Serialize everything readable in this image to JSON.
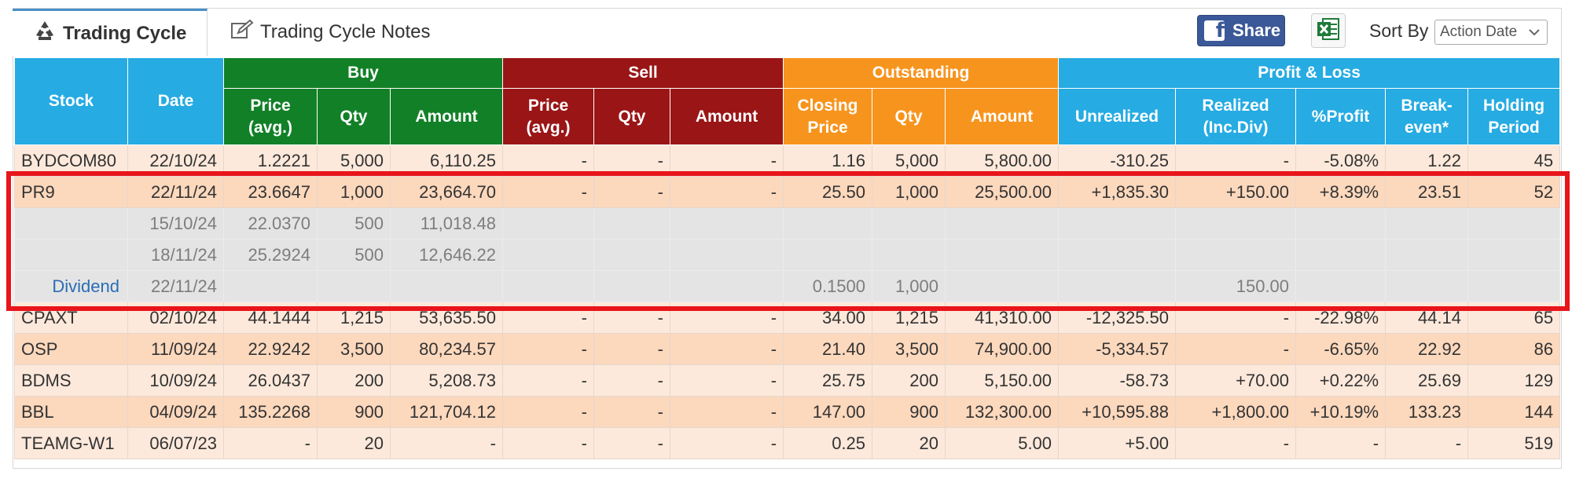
{
  "tabs": {
    "active": "Trading Cycle",
    "inactive": "Trading Cycle Notes"
  },
  "toolbar": {
    "share_label": "Share",
    "sort_label": "Sort By",
    "sort_value": "Action Date",
    "facebook_color": "#3b5998",
    "excel_color": "#1f7a3a"
  },
  "headers": {
    "stock": "Stock",
    "date": "Date",
    "groups": [
      "Buy",
      "Sell",
      "Outstanding",
      "Profit & Loss"
    ],
    "buy": [
      "Price (avg.)",
      "Qty",
      "Amount"
    ],
    "sell": [
      "Price (avg.)",
      "Qty",
      "Amount"
    ],
    "outstanding": [
      "Closing Price",
      "Qty",
      "Amount"
    ],
    "pl": [
      "Unrealized",
      "Realized (Inc.Div)",
      "%Profit",
      "Break-even*",
      "Holding Period"
    ]
  },
  "header_lines": {
    "price_avg": [
      "Price",
      "(avg.)"
    ],
    "closing_price": [
      "Closing",
      "Price"
    ],
    "realized": [
      "Realized",
      "(Inc.Div)"
    ],
    "break_even": [
      "Break-",
      "even*"
    ],
    "holding": [
      "Holding",
      "Period"
    ]
  },
  "colors": {
    "header_blue": "#26abe2",
    "header_green": "#128027",
    "header_red": "#9a1516",
    "header_orange": "#f7941d",
    "row_light": "#fde9db",
    "row_dark": "#fcd8bd",
    "row_detail": "#e4e4e4",
    "highlight": "#e8151b"
  },
  "rows": [
    {
      "style": "light",
      "stock": "BYDCOM80",
      "date": "22/10/24",
      "buy_price": "1.2221",
      "buy_qty": "5,000",
      "buy_amount": "6,110.25",
      "sell_price": "-",
      "sell_qty": "-",
      "sell_amount": "-",
      "close_price": "1.16",
      "out_qty": "5,000",
      "out_amount": "5,800.00",
      "unrealized": "-310.25",
      "realized": "-",
      "pct": "-5.08%",
      "breakeven": "1.22",
      "holding": "45"
    },
    {
      "style": "dark",
      "stock": "PR9",
      "date": "22/11/24",
      "buy_price": "23.6647",
      "buy_qty": "1,000",
      "buy_amount": "23,664.70",
      "sell_price": "-",
      "sell_qty": "-",
      "sell_amount": "-",
      "close_price": "25.50",
      "out_qty": "1,000",
      "out_amount": "25,500.00",
      "unrealized": "+1,835.30",
      "realized": "+150.00",
      "pct": "+8.39%",
      "breakeven": "23.51",
      "holding": "52"
    },
    {
      "style": "gray",
      "stock": "",
      "date": "15/10/24",
      "buy_price": "22.0370",
      "buy_qty": "500",
      "buy_amount": "11,018.48",
      "sell_price": "",
      "sell_qty": "",
      "sell_amount": "",
      "close_price": "",
      "out_qty": "",
      "out_amount": "",
      "unrealized": "",
      "realized": "",
      "pct": "",
      "breakeven": "",
      "holding": ""
    },
    {
      "style": "gray",
      "stock": "",
      "date": "18/11/24",
      "buy_price": "25.2924",
      "buy_qty": "500",
      "buy_amount": "12,646.22",
      "sell_price": "",
      "sell_qty": "",
      "sell_amount": "",
      "close_price": "",
      "out_qty": "",
      "out_amount": "",
      "unrealized": "",
      "realized": "",
      "pct": "",
      "breakeven": "",
      "holding": ""
    },
    {
      "style": "gray-div",
      "stock": "Dividend",
      "date": "22/11/24",
      "buy_price": "",
      "buy_qty": "",
      "buy_amount": "",
      "sell_price": "",
      "sell_qty": "",
      "sell_amount": "",
      "close_price": "0.1500",
      "out_qty": "1,000",
      "out_amount": "",
      "unrealized": "",
      "realized": "150.00",
      "pct": "",
      "breakeven": "",
      "holding": ""
    },
    {
      "style": "light",
      "stock": "CPAXT",
      "date": "02/10/24",
      "buy_price": "44.1444",
      "buy_qty": "1,215",
      "buy_amount": "53,635.50",
      "sell_price": "-",
      "sell_qty": "-",
      "sell_amount": "-",
      "close_price": "34.00",
      "out_qty": "1,215",
      "out_amount": "41,310.00",
      "unrealized": "-12,325.50",
      "realized": "-",
      "pct": "-22.98%",
      "breakeven": "44.14",
      "holding": "65"
    },
    {
      "style": "dark",
      "stock": "OSP",
      "date": "11/09/24",
      "buy_price": "22.9242",
      "buy_qty": "3,500",
      "buy_amount": "80,234.57",
      "sell_price": "-",
      "sell_qty": "-",
      "sell_amount": "-",
      "close_price": "21.40",
      "out_qty": "3,500",
      "out_amount": "74,900.00",
      "unrealized": "-5,334.57",
      "realized": "-",
      "pct": "-6.65%",
      "breakeven": "22.92",
      "holding": "86"
    },
    {
      "style": "light",
      "stock": "BDMS",
      "date": "10/09/24",
      "buy_price": "26.0437",
      "buy_qty": "200",
      "buy_amount": "5,208.73",
      "sell_price": "-",
      "sell_qty": "-",
      "sell_amount": "-",
      "close_price": "25.75",
      "out_qty": "200",
      "out_amount": "5,150.00",
      "unrealized": "-58.73",
      "realized": "+70.00",
      "pct": "+0.22%",
      "breakeven": "25.69",
      "holding": "129"
    },
    {
      "style": "dark",
      "stock": "BBL",
      "date": "04/09/24",
      "buy_price": "135.2268",
      "buy_qty": "900",
      "buy_amount": "121,704.12",
      "sell_price": "-",
      "sell_qty": "-",
      "sell_amount": "-",
      "close_price": "147.00",
      "out_qty": "900",
      "out_amount": "132,300.00",
      "unrealized": "+10,595.88",
      "realized": "+1,800.00",
      "pct": "+10.19%",
      "breakeven": "133.23",
      "holding": "144"
    },
    {
      "style": "light",
      "stock": "TEAMG-W1",
      "date": "06/07/23",
      "buy_price": "-",
      "buy_qty": "20",
      "buy_amount": "-",
      "sell_price": "-",
      "sell_qty": "-",
      "sell_amount": "-",
      "close_price": "0.25",
      "out_qty": "20",
      "out_amount": "5.00",
      "unrealized": "+5.00",
      "realized": "-",
      "pct": "-",
      "breakeven": "-",
      "holding": "519"
    }
  ]
}
